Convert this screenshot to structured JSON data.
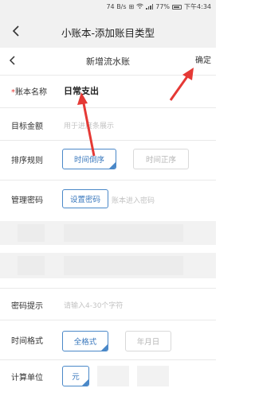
{
  "status_bar": {
    "speed": "74 B/s",
    "battery": "77%",
    "time": "下午4:34",
    "icons": [
      "sim-icon",
      "wifi-icon",
      "signal-icon",
      "battery-icon"
    ]
  },
  "app_bar": {
    "title": "小账本-添加账目类型",
    "back_icon": "chevron-left-icon"
  },
  "nav_bar": {
    "title": "新增流水账",
    "confirm_label": "确定",
    "back_icon": "chevron-left-icon"
  },
  "form": {
    "account_name": {
      "required_mark": "*",
      "label": "账本名称",
      "value": "日常支出"
    },
    "target_amount": {
      "label": "目标金额",
      "placeholder": "用于进度条展示"
    },
    "sort_rule": {
      "label": "排序规则",
      "options": [
        "时间倒序",
        "时间正序"
      ],
      "selected": "时间倒序"
    },
    "admin_password": {
      "label": "管理密码",
      "button_label": "设置密码",
      "hint": "账本进入密码"
    },
    "password_hint": {
      "label": "密码提示",
      "placeholder": "请输入4-30个字符"
    },
    "time_format": {
      "label": "时间格式",
      "options": [
        "全格式",
        "年月日"
      ],
      "selected": "全格式"
    },
    "unit": {
      "label": "计算单位",
      "options": [
        "元"
      ],
      "selected": "元"
    }
  },
  "colors": {
    "accent": "#4a88c8",
    "arrow": "#e53935",
    "required": "#e53935",
    "header_bg": "#f1f1f1"
  }
}
